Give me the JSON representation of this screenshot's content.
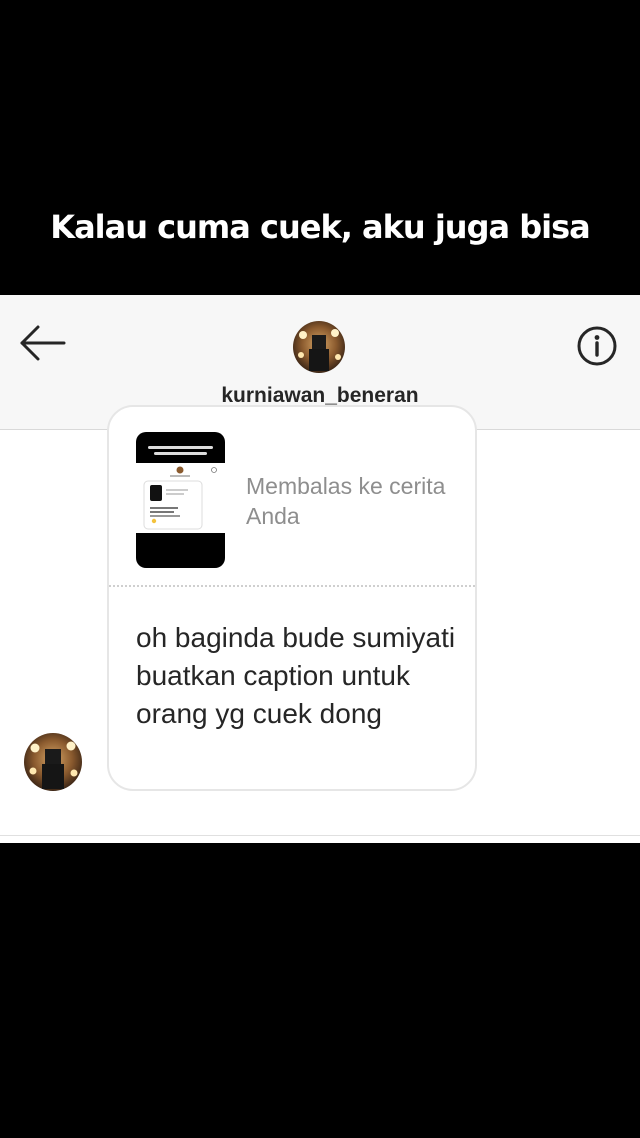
{
  "meme": {
    "headline": "Kalau cuma cuek, aku juga bisa"
  },
  "header": {
    "username": "kurniawan_beneran",
    "back_icon": "arrow-left-icon",
    "info_icon": "info-circle-icon"
  },
  "message": {
    "reply_label": "Membalas ke cerita Anda",
    "text": "oh baginda bude sumiyati buatkan caption untuk orang yg cuek dong"
  },
  "colors": {
    "header_bg": "#f7f7f7",
    "text_primary": "#262626",
    "text_secondary": "#8e8e8e",
    "bubble_border": "#e6e6e6"
  }
}
